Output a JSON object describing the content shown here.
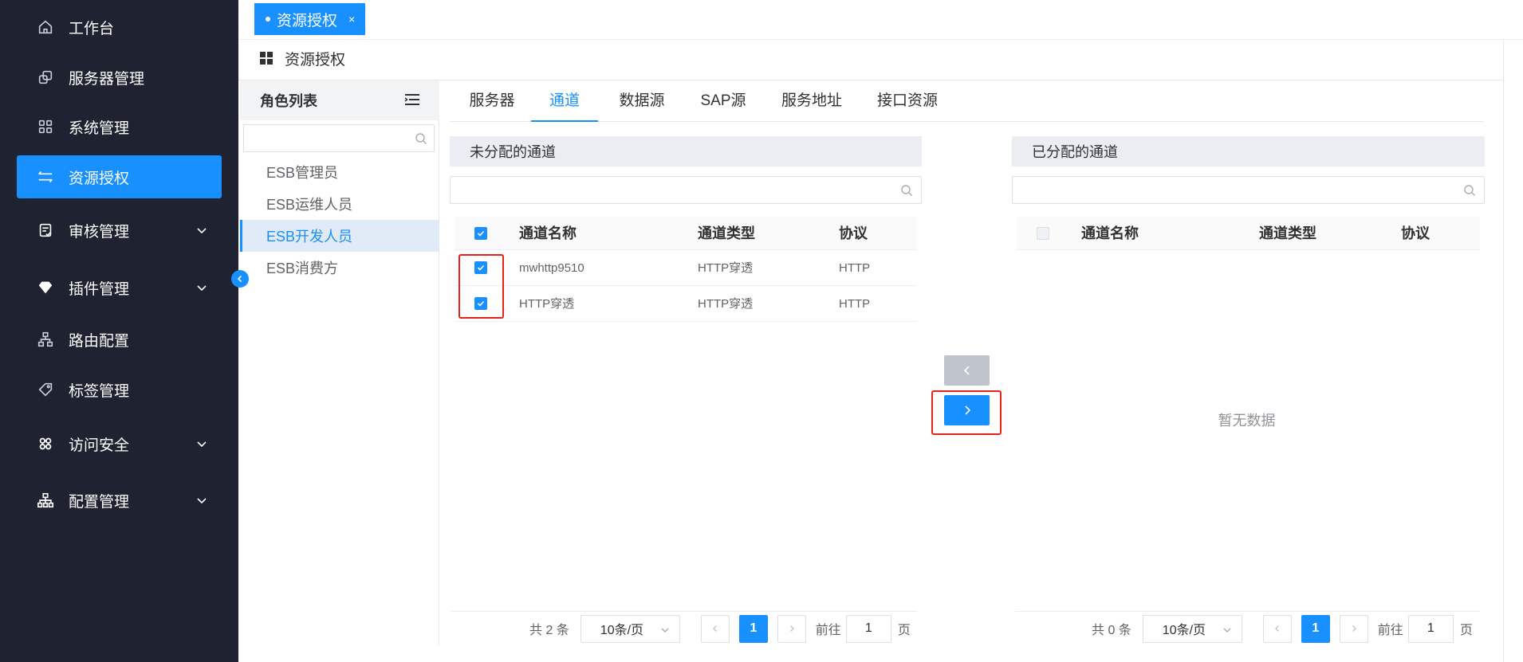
{
  "sidebar": {
    "items": [
      {
        "label": "工作台",
        "icon": "home-icon"
      },
      {
        "label": "服务器管理",
        "icon": "server-icon"
      },
      {
        "label": "系统管理",
        "icon": "apps-icon"
      },
      {
        "label": "资源授权",
        "icon": "transfer-icon",
        "active": true
      },
      {
        "label": "审核管理",
        "icon": "audit-icon",
        "expandable": true
      },
      {
        "label": "插件管理",
        "icon": "gem-icon",
        "expandable": true
      },
      {
        "label": "路由配置",
        "icon": "sitemap-icon"
      },
      {
        "label": "标签管理",
        "icon": "tag-icon"
      },
      {
        "label": "访问安全",
        "icon": "security-icon",
        "expandable": true
      },
      {
        "label": "配置管理",
        "icon": "hierarchy-icon",
        "expandable": true
      }
    ]
  },
  "tagbar": {
    "tag_label": "资源授权",
    "close": "×"
  },
  "page": {
    "title": "资源授权"
  },
  "roles": {
    "header": "角色列表",
    "search_placeholder": "",
    "items": [
      "ESB管理员",
      "ESB运维人员",
      "ESB开发人员",
      "ESB消费方"
    ],
    "selected_index": 2
  },
  "tabs": [
    "服务器",
    "通道",
    "数据源",
    "SAP源",
    "服务地址",
    "接口资源"
  ],
  "active_tab": 1,
  "left_panel": {
    "title": "未分配的通道",
    "columns": [
      "通道名称",
      "通道类型",
      "协议"
    ],
    "rows": [
      {
        "name": "mwhttp9510",
        "type": "HTTP穿透",
        "protocol": "HTTP",
        "checked": true
      },
      {
        "name": "HTTP穿透",
        "type": "HTTP穿透",
        "protocol": "HTTP",
        "checked": true
      }
    ],
    "pager": {
      "total": "共 2 条",
      "size": "10条/页",
      "page": "1",
      "goto": "前往",
      "goto_value": "1",
      "unit": "页"
    }
  },
  "right_panel": {
    "title": "已分配的通道",
    "columns": [
      "通道名称",
      "通道类型",
      "协议"
    ],
    "empty": "暂无数据",
    "pager": {
      "total": "共 0 条",
      "size": "10条/页",
      "page": "1",
      "goto": "前往",
      "goto_value": "1",
      "unit": "页"
    }
  },
  "colors": {
    "accent": "#1890ff",
    "sidebar_bg": "#1f2231",
    "highlight": "#e5221b"
  }
}
